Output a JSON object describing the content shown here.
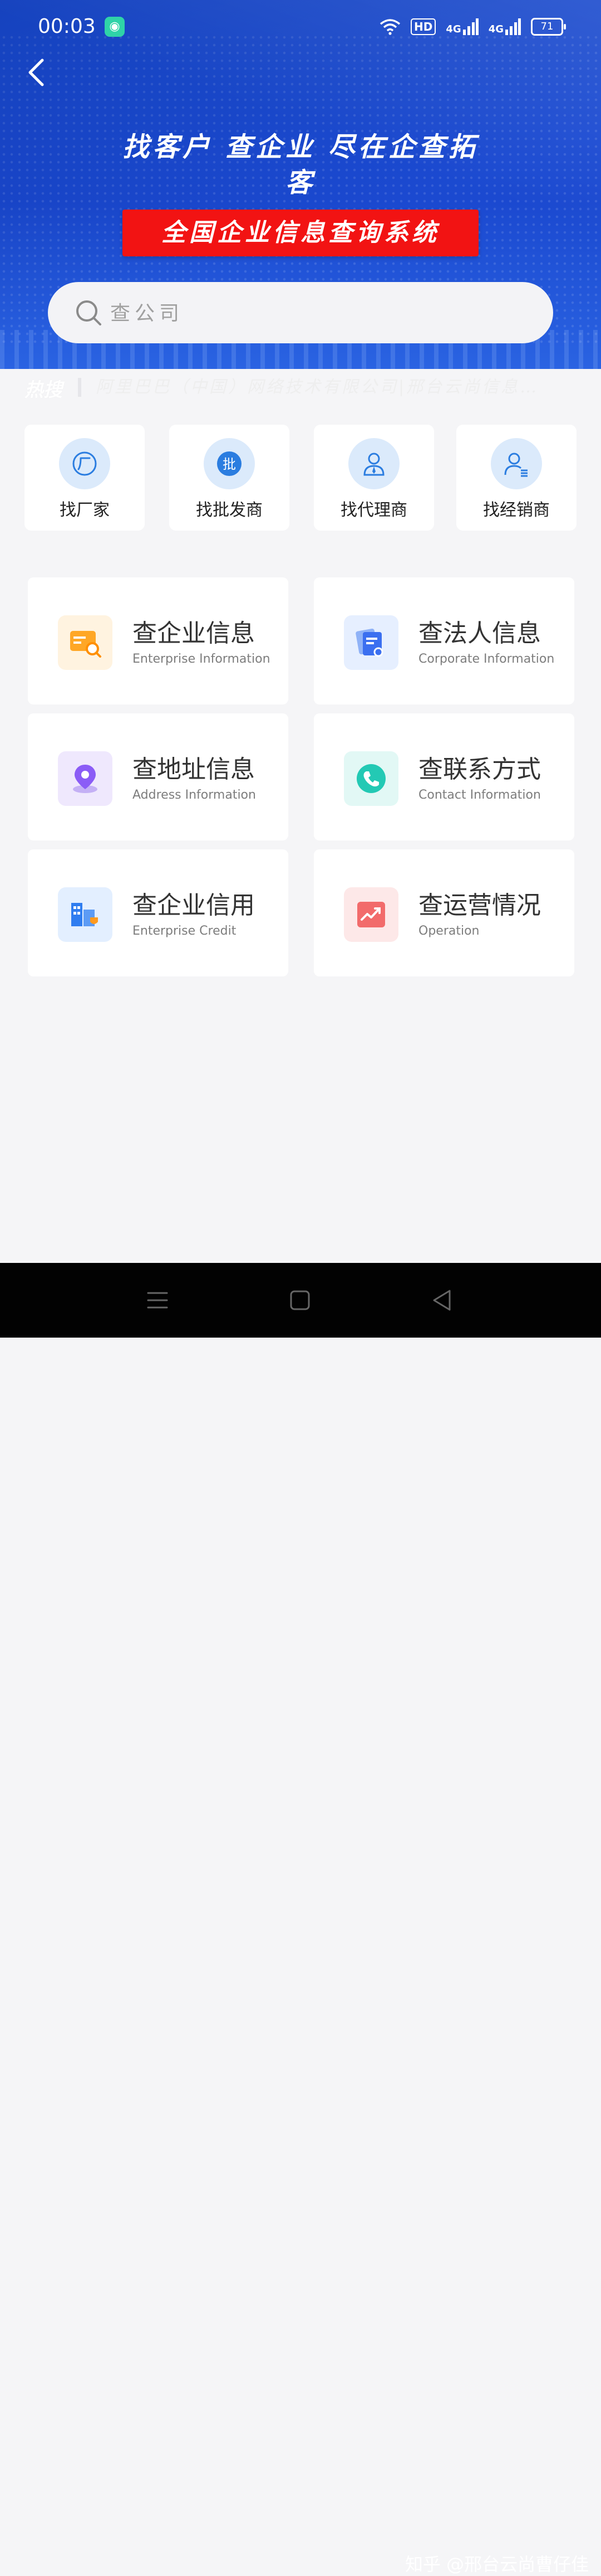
{
  "status_bar": {
    "time": "00:03",
    "hd": "HD",
    "net1": "4G",
    "net2": "4G",
    "battery": "71"
  },
  "header": {
    "headline": "找客户 查企业 尽在企查拓客",
    "banner": "全国企业信息查询系统"
  },
  "search": {
    "placeholder": "查公司"
  },
  "hot_search": {
    "label": "热搜",
    "text": "阿里巴巴（中国）网络技术有限公司|邢台云尚信息…"
  },
  "quick_links": [
    {
      "label": "找厂家",
      "icon": "factory-icon"
    },
    {
      "label": "找批发商",
      "icon": "wholesale-icon"
    },
    {
      "label": "找代理商",
      "icon": "agent-icon"
    },
    {
      "label": "找经销商",
      "icon": "dealer-icon"
    }
  ],
  "features": [
    {
      "title": "查企业信息",
      "subtitle": "Enterprise Information",
      "icon": "enterprise-card-icon",
      "color": "#ff9a1f"
    },
    {
      "title": "查法人信息",
      "subtitle": "Corporate Information",
      "icon": "corporate-docs-icon",
      "color": "#3b6ff0"
    },
    {
      "title": "查地址信息",
      "subtitle": "Address Information",
      "icon": "location-pin-icon",
      "color": "#8b5cf6"
    },
    {
      "title": "查联系方式",
      "subtitle": "Contact Information",
      "icon": "phone-icon",
      "color": "#23c9b4"
    },
    {
      "title": "查企业信用",
      "subtitle": "Enterprise Credit",
      "icon": "building-credit-icon",
      "color": "#2f7df0"
    },
    {
      "title": "查运营情况",
      "subtitle": "Operation",
      "icon": "trend-chart-icon",
      "color": "#f26b6b"
    }
  ],
  "watermark": "知乎 @邢台云尚曹仔佳",
  "colors": {
    "hero_blue": "#1d4fd6",
    "banner_red": "#f21313",
    "page_bg": "#f5f5f7"
  }
}
